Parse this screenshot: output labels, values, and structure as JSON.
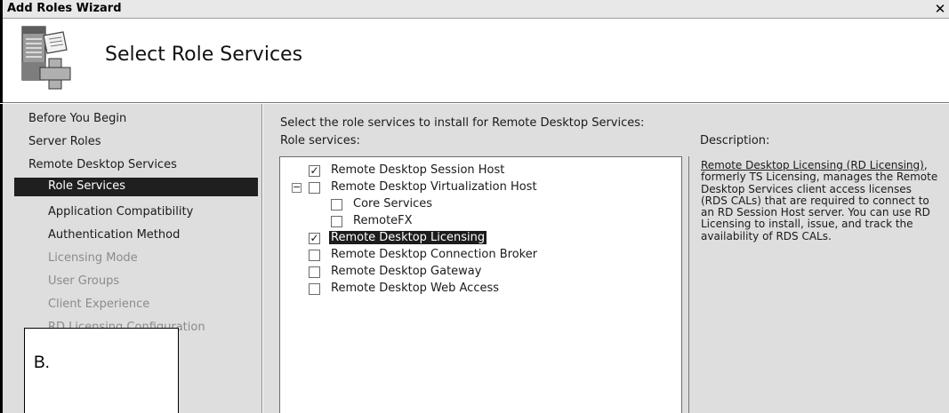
{
  "window": {
    "title": "Add Roles Wizard",
    "close_glyph": "✕"
  },
  "header": {
    "icon": "server-roles-icon",
    "heading": "Select Role Services"
  },
  "nav": {
    "items": [
      {
        "label": "Before You Begin",
        "state": "normal"
      },
      {
        "label": "Server Roles",
        "state": "normal"
      },
      {
        "label": "Remote Desktop Services",
        "state": "normal"
      },
      {
        "label": "Role Services",
        "state": "selected"
      },
      {
        "label": "Application Compatibility",
        "state": "normal"
      },
      {
        "label": "Authentication Method",
        "state": "normal"
      },
      {
        "label": "Licensing Mode",
        "state": "dim"
      },
      {
        "label": "User Groups",
        "state": "dim"
      },
      {
        "label": "Client Experience",
        "state": "dim"
      },
      {
        "label": "RD Licensing Configuration",
        "state": "dim"
      }
    ]
  },
  "overlay": {
    "label": "B."
  },
  "content": {
    "instruction": "Select the role services to install for Remote Desktop Services:",
    "role_services_label": "Role services:",
    "description_label": "Description:",
    "tree": [
      {
        "label": "Remote Desktop Session Host",
        "checked": true
      },
      {
        "label": "Remote Desktop Virtualization Host",
        "checked": false,
        "expanded": true,
        "expander_glyph": "−"
      },
      {
        "label": "Core Services",
        "checked": false
      },
      {
        "label": "RemoteFX",
        "checked": false
      },
      {
        "label": "Remote Desktop Licensing",
        "checked": true,
        "selected": true
      },
      {
        "label": "Remote Desktop Connection Broker",
        "checked": false
      },
      {
        "label": "Remote Desktop Gateway",
        "checked": false
      },
      {
        "label": "Remote Desktop Web Access",
        "checked": false
      }
    ],
    "check_glyph": "✓",
    "description": {
      "link": "Remote Desktop Licensing (RD Licensing)",
      "text": ", formerly TS Licensing, manages the Remote Desktop Services client access licenses (RDS CALs) that are required to connect to an RD Session Host server. You can use RD Licensing to install, issue, and track the availability of RDS CALs."
    }
  },
  "colors": {
    "panel_bg": "#dedede",
    "selection_bg": "#1c1c1c",
    "selection_text": "#ffffff"
  }
}
